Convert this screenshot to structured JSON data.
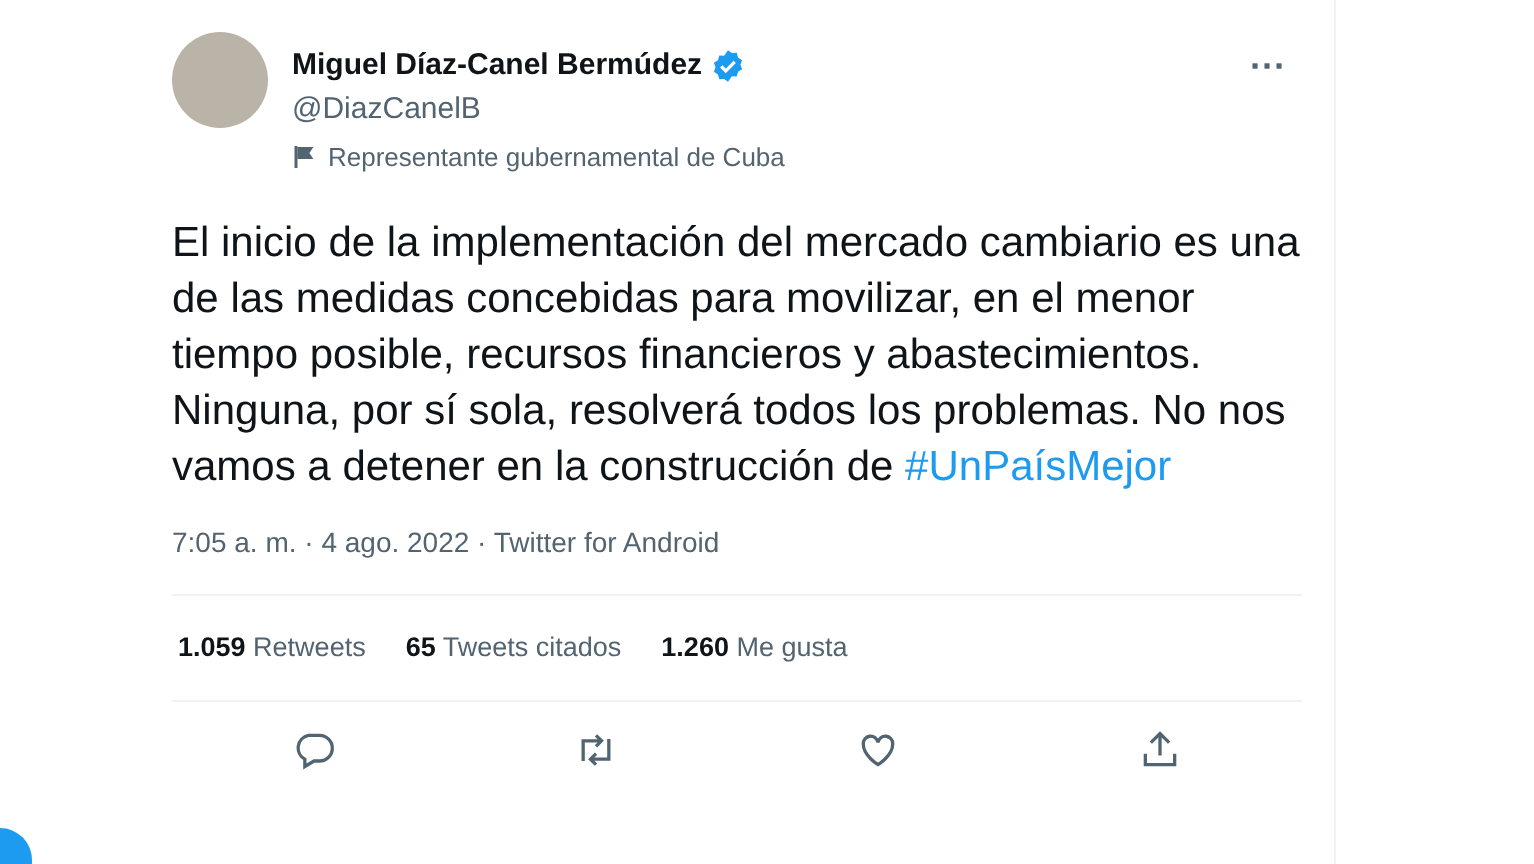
{
  "author": {
    "name": "Miguel Díaz-Canel Bermúdez",
    "verified": true,
    "handle": "@DiazCanelB",
    "label": "Representante gubernamental de Cuba"
  },
  "more_icon": "···",
  "tweet": {
    "text": "El inicio de la implementación del mercado cambiario es una de las medidas concebidas para movilizar, en el menor tiempo posible, recursos financieros y abastecimientos. Ninguna, por sí sola, resolverá todos los problemas. No nos vamos a detener en la construcción de ",
    "hashtag": "#UnPaísMejor"
  },
  "meta": {
    "timestamp": "7:05 a. m. · 4 ago. 2022 · Twitter for Android"
  },
  "stats": [
    {
      "count": "1.059",
      "label": "Retweets"
    },
    {
      "count": "65",
      "label": "Tweets citados"
    },
    {
      "count": "1.260",
      "label": "Me gusta"
    }
  ],
  "actions": [
    {
      "kind": "reply"
    },
    {
      "kind": "retweet"
    },
    {
      "kind": "like"
    },
    {
      "kind": "share"
    }
  ]
}
